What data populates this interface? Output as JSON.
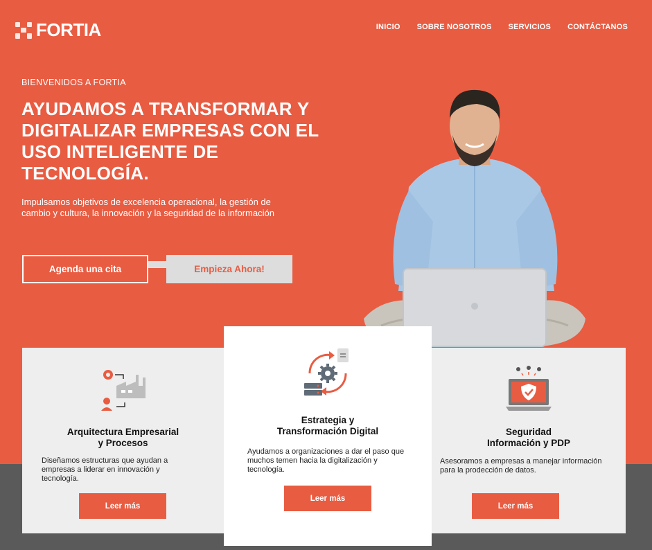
{
  "header": {
    "logo_text": "FORTIA",
    "nav": [
      "INICIO",
      "SOBRE NOSOTROS",
      "SERVICIOS",
      "CONTÁCTANOS"
    ]
  },
  "hero": {
    "kicker": "BIENVENIDOS A FORTIA",
    "headline": "AYUDAMOS A TRANSFORMAR Y DIGITALIZAR EMPRESAS CON EL USO INTELIGENTE DE TECNOLOGÍA.",
    "lead": "Impulsamos objetivos de excelencia operacional, la gestión de cambio y cultura, la innovación y la seguridad de la información",
    "cta_primary": "Agenda una cita",
    "cta_secondary": "Empieza Ahora!"
  },
  "cards": [
    {
      "title_line1": "Arquitectura Empresarial",
      "title_line2": "y Procesos",
      "text": "Diseñamos estructuras que ayudan a empresas a liderar en innovación y tecnología.",
      "button": "Leer más",
      "icon": "factory-process-icon"
    },
    {
      "title_line1": "Estrategia y",
      "title_line2": "Transformación Digital",
      "text": "Ayudamos a organizaciones a dar el paso que muchos temen hacia la digitalización y tecnología.",
      "button": "Leer más",
      "icon": "gear-cycle-icon"
    },
    {
      "title_line1": "Seguridad",
      "title_line2": "Información y PDP",
      "text": "Asesoramos a empresas a manejar información para la prodección de datos.",
      "button": "Leer más",
      "icon": "shield-laptop-icon"
    }
  ],
  "colors": {
    "brand": "#e85c42",
    "band": "#5a5a5a",
    "card_grey": "#eeeeee"
  }
}
